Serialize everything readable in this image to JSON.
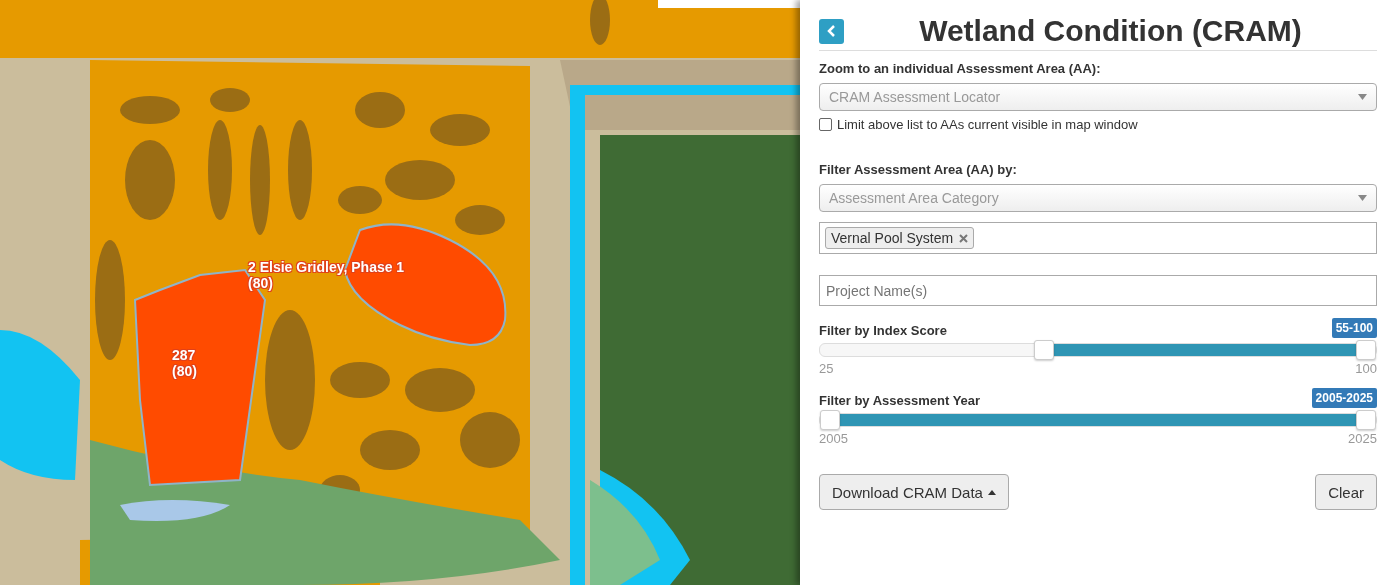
{
  "map": {
    "labels": [
      {
        "text": "2 Elsie Gridley, Phase 1\n(80)"
      },
      {
        "text": "287\n(80)"
      }
    ]
  },
  "panel": {
    "title": "Wetland Condition (CRAM)",
    "zoom": {
      "label": "Zoom to an individual Assessment Area (AA):",
      "placeholder": "CRAM Assessment Locator",
      "limit_label": "Limit above list to AAs current visible in map window",
      "limit_checked": false
    },
    "filter": {
      "label": "Filter Assessment Area (AA) by:",
      "category_placeholder": "Assessment Area Category",
      "tags": [
        "Vernal Pool System"
      ],
      "project_placeholder": "Project Name(s)"
    },
    "sliders": [
      {
        "label": "Filter by Index Score",
        "badge": "55-100",
        "min": "25",
        "max": "100",
        "handles": [
          {
            "level": 0.4
          },
          {
            "level": 1
          }
        ]
      },
      {
        "label": "Filter by Assessment Year",
        "badge": "2005-2025",
        "min": "2005",
        "max": "2025",
        "handles": [
          {
            "level": 0
          },
          {
            "level": 1
          }
        ]
      }
    ],
    "buttons": {
      "download": "Download CRAM Data",
      "clear": "Clear"
    }
  }
}
